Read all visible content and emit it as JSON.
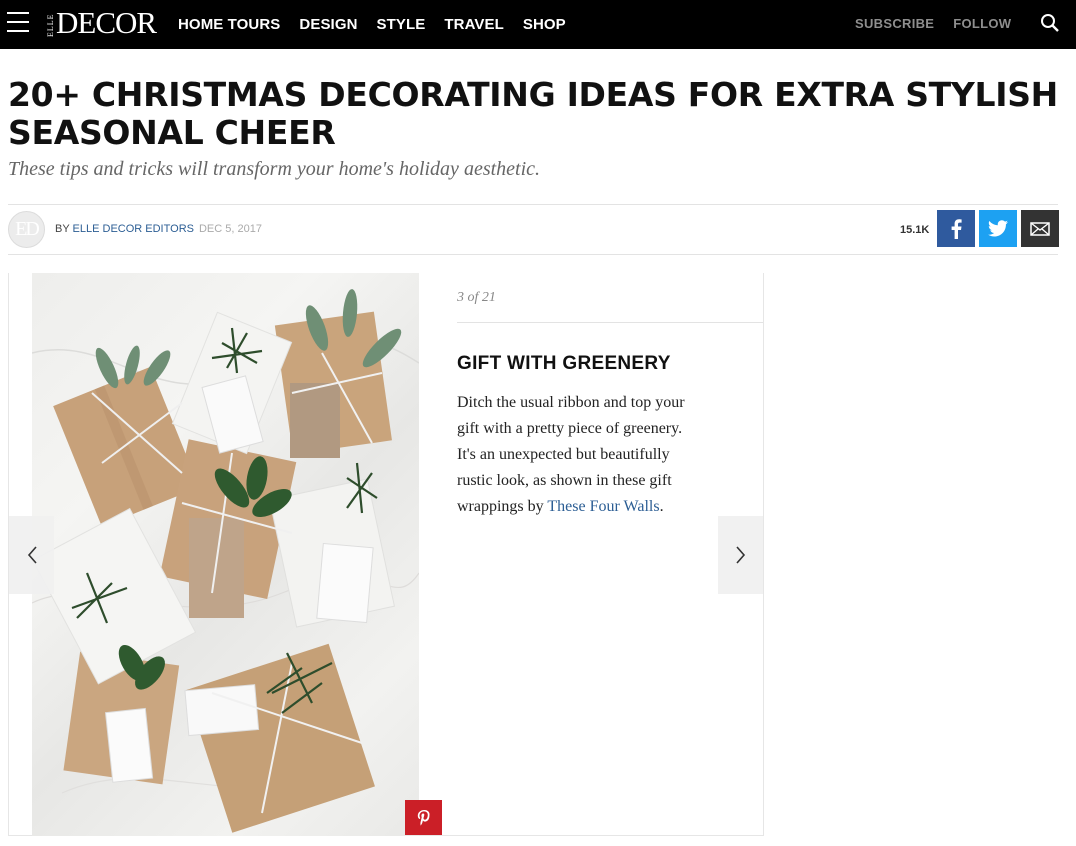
{
  "nav": {
    "logo_small": "ELLE",
    "logo_main": "DECOR",
    "items": [
      "HOME TOURS",
      "DESIGN",
      "STYLE",
      "TRAVEL",
      "SHOP"
    ],
    "subscribe": "SUBSCRIBE",
    "follow": "FOLLOW"
  },
  "article": {
    "headline": "20+ CHRISTMAS DECORATING IDEAS FOR EXTRA STYLISH SEASONAL CHEER",
    "dek": "These tips and tricks will transform your home's holiday aesthetic.",
    "avatar_initials": "ED",
    "by": "BY ",
    "author": "ELLE DECOR EDITORS",
    "date": "DEC 5, 2017",
    "share_count": "15.1K"
  },
  "gallery": {
    "counter": "3 of 21",
    "slide_title": "GIFT WITH GREENERY",
    "body_text": "Ditch the usual ribbon and top your gift with a pretty piece of greenery. It's an unexpected but beautifully rustic look, as shown in these gift wrappings by ",
    "body_link": "These Four Walls",
    "body_end": "."
  },
  "icons": {
    "menu": "hamburger-icon",
    "search": "search-icon",
    "facebook": "facebook-icon",
    "twitter": "twitter-icon",
    "email": "email-icon",
    "pinterest": "pinterest-icon",
    "prev": "chevron-left-icon",
    "next": "chevron-right-icon"
  },
  "colors": {
    "facebook": "#2f5a9e",
    "twitter": "#1da1f2",
    "pinterest": "#cb1f27",
    "link": "#2c5e94"
  }
}
